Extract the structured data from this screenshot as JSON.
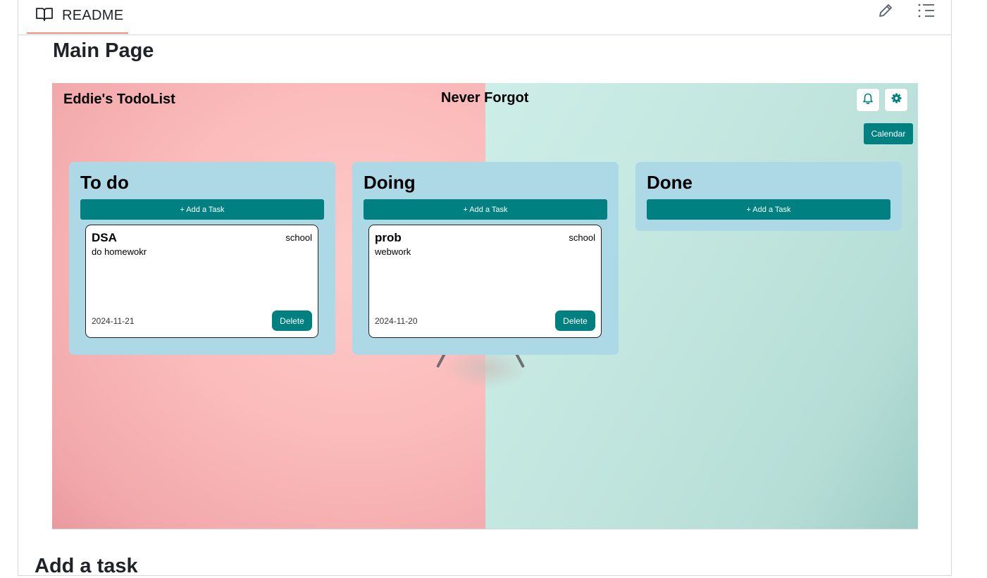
{
  "readme": {
    "tab_label": "README",
    "page_title": "Main Page",
    "next_heading": "Add a task"
  },
  "app": {
    "title": "Eddie's TodoList",
    "slogan": "Never Forgot",
    "calendar_label": "Calendar",
    "icons": [
      "bell-icon",
      "gear-icon"
    ],
    "accent_color": "#008080",
    "column_color": "#add8e6",
    "columns": [
      {
        "title": "To do",
        "add_label": "+ Add a Task",
        "cards": [
          {
            "title": "DSA",
            "tag": "school",
            "description": "do homewokr",
            "date": "2024-11-21",
            "delete_label": "Delete"
          }
        ]
      },
      {
        "title": "Doing",
        "add_label": "+ Add a Task",
        "cards": [
          {
            "title": "prob",
            "tag": "school",
            "description": "webwork",
            "date": "2024-11-20",
            "delete_label": "Delete"
          }
        ]
      },
      {
        "title": "Done",
        "add_label": "+ Add a Task",
        "cards": []
      }
    ]
  }
}
